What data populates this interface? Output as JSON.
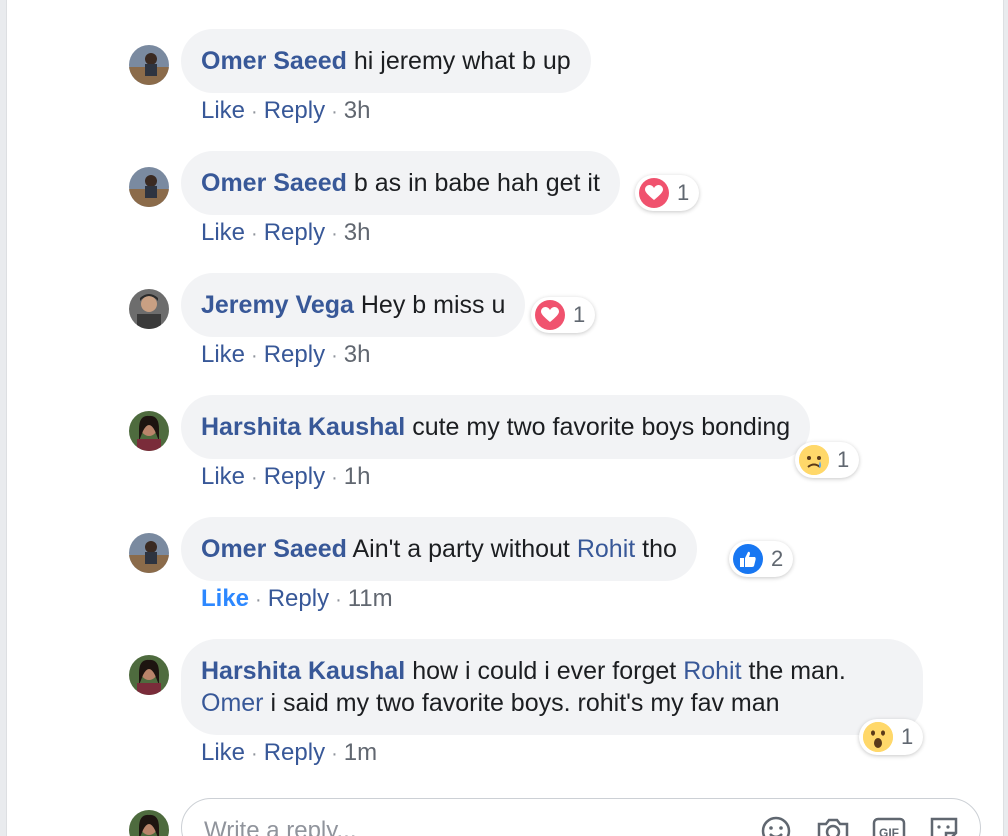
{
  "comments": [
    {
      "name": "Omer Saeed",
      "text": "hi jeremy what b up",
      "like": "Like",
      "reply": "Reply",
      "time": "3h"
    },
    {
      "name": "Omer Saeed",
      "text": "b as in babe hah get it",
      "like": "Like",
      "reply": "Reply",
      "time": "3h",
      "reaction": {
        "icon": "heart-reaction-icon",
        "count": "1"
      }
    },
    {
      "name": "Jeremy Vega",
      "text": "Hey b miss u",
      "like": "Like",
      "reply": "Reply",
      "time": "3h",
      "reaction": {
        "icon": "heart-reaction-icon",
        "count": "1"
      }
    },
    {
      "name": "Harshita Kaushal",
      "text": "cute my two favorite boys bonding",
      "like": "Like",
      "reply": "Reply",
      "time": "1h",
      "reaction": {
        "icon": "sad-reaction-icon",
        "count": "1"
      }
    },
    {
      "name": "Omer Saeed",
      "text_before": "Ain't a party without",
      "mention": "Rohit",
      "text_after": "tho",
      "like": "Like",
      "reply": "Reply",
      "time": "11m",
      "liked": true,
      "reaction": {
        "icon": "like-reaction-icon",
        "count": "2"
      }
    },
    {
      "name": "Harshita Kaushal",
      "text_before": "how i could i ever forget",
      "mention": "Rohit",
      "text_after": "the man.",
      "mention2": "Omer",
      "text_line2": "i said my two favorite boys. rohit's my fav man",
      "like": "Like",
      "reply": "Reply",
      "time": "1m",
      "reaction": {
        "icon": "wow-reaction-icon",
        "count": "1"
      }
    }
  ],
  "reply_box": {
    "placeholder": "Write a reply..."
  },
  "colors": {
    "name": "#385898",
    "bubble": "#f2f3f5",
    "heart": "#f0526e",
    "like": "#1877f2"
  }
}
